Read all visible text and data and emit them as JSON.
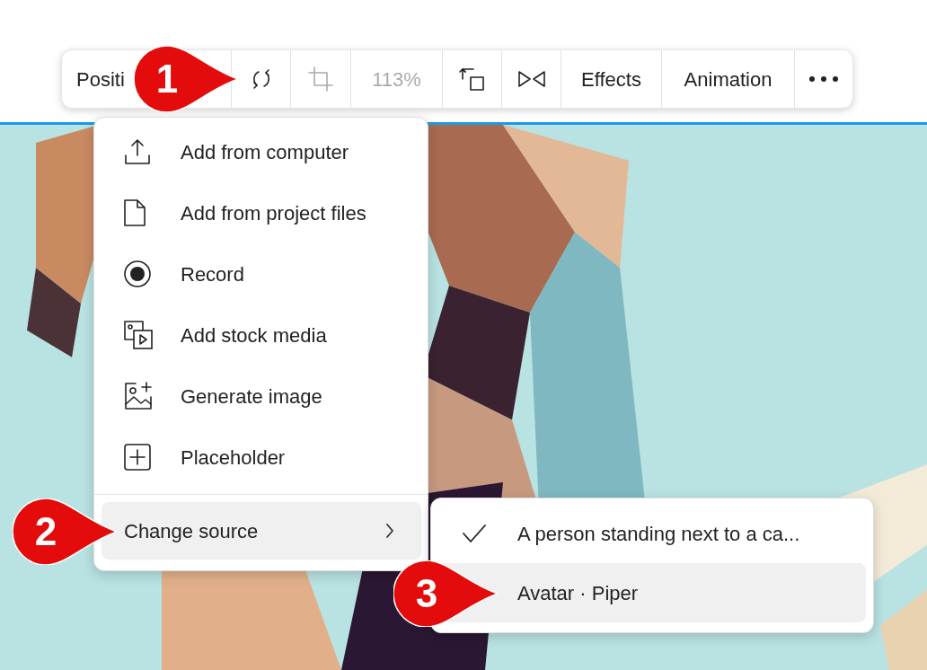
{
  "toolbar": [
    {
      "kind": "text",
      "label": "Positi",
      "disabled": false
    },
    {
      "kind": "icon",
      "disabled": false
    },
    {
      "kind": "icon",
      "disabled": true
    },
    {
      "kind": "text",
      "label": "113%",
      "disabled": true
    },
    {
      "kind": "icon",
      "disabled": false
    },
    {
      "kind": "icon",
      "disabled": false
    },
    {
      "kind": "text",
      "label": "Effects",
      "disabled": false
    },
    {
      "kind": "text",
      "label": "Animation",
      "disabled": false
    },
    {
      "kind": "icon",
      "disabled": false
    }
  ],
  "menu": {
    "items": [
      {
        "label": "Add from computer"
      },
      {
        "label": "Add from project files"
      },
      {
        "label": "Record"
      },
      {
        "label": "Add stock media"
      },
      {
        "label": "Generate image"
      },
      {
        "label": "Placeholder"
      }
    ],
    "submenu_trigger": {
      "label": "Change source",
      "expanded": true
    }
  },
  "submenu": [
    {
      "label": "A person standing next to a ca...",
      "checked": true,
      "selected": false
    },
    {
      "label": "Avatar · Piper",
      "checked": false,
      "selected": true
    }
  ],
  "callouts": [
    "1",
    "2",
    "3"
  ]
}
